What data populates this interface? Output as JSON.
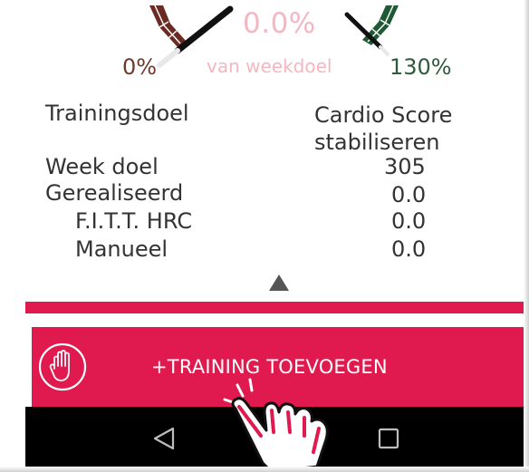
{
  "gauge": {
    "percentage": "0.0%",
    "subtitle": "van weekdoel",
    "min_label": "0%",
    "max_label": "130%"
  },
  "info": {
    "training_goal_label": "Trainingsdoel",
    "training_goal_value_line1": "Cardio Score",
    "training_goal_value_line2": "stabiliseren",
    "week_goal_label": "Week doel",
    "week_goal_value": "305",
    "realized_label": "Gerealiseerd",
    "realized_value": "0.0",
    "fitt_label": "F.I.T.T.  HRC",
    "fitt_value": "0.0",
    "manual_label": "Manueel",
    "manual_value": "0.0"
  },
  "actions": {
    "add_training_label": "+TRAINING TOEVOEGEN",
    "hand_icon": "stop-hand-icon"
  },
  "navbar": {
    "back_icon": "back-triangle-icon",
    "home_icon": "home-circle-icon",
    "recent_icon": "recent-apps-square-icon"
  },
  "colors": {
    "accent": "#e01a4f",
    "gauge_text": "#f4b7c2",
    "gauge_low": "#6b2a22",
    "gauge_high": "#1f5a34",
    "text": "#333333",
    "navbar": "#000000"
  }
}
